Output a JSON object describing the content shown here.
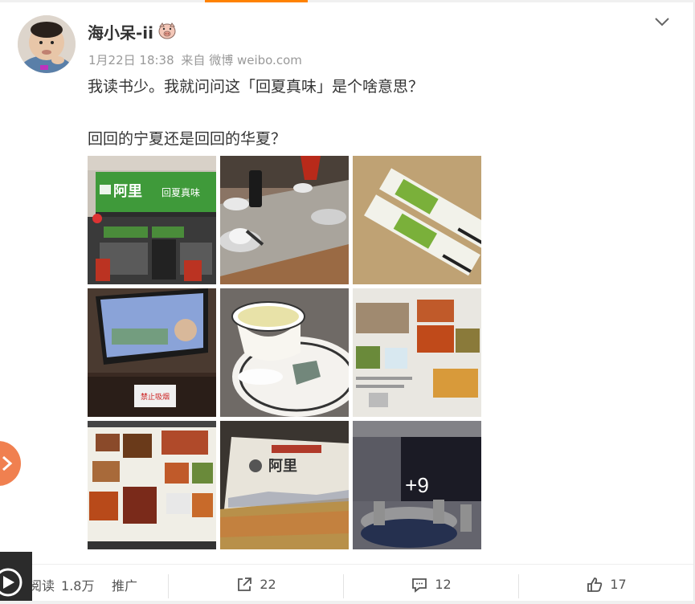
{
  "post": {
    "username": "海小呆-ii",
    "badge_icon": "pig-face-icon",
    "meta": {
      "time": "1月22日 18:38",
      "source": "来自 微博 weibo.com"
    },
    "text_line1": "我读书少。我就问问这「回夏真味」是个啥意思？",
    "text_line2": "回回的宁夏还是回回的华夏？",
    "images": [
      {
        "name": "restaurant-storefront-image",
        "sign": "阿里",
        "sign_sub": "回夏真味"
      },
      {
        "name": "table-setting-image"
      },
      {
        "name": "chopsticks-image"
      },
      {
        "name": "tv-screen-image",
        "sign": "禁止吸烟"
      },
      {
        "name": "teacup-image"
      },
      {
        "name": "menu-page-image"
      },
      {
        "name": "menu-spread-image"
      },
      {
        "name": "menu-cover-image"
      },
      {
        "name": "dining-room-image"
      }
    ],
    "more_count": "+9"
  },
  "footer": {
    "read_label": "阅读",
    "read_count": "1.8万",
    "promote_label": "推广",
    "share_count": "22",
    "comment_count": "12",
    "like_count": "17"
  },
  "colors": {
    "accent": "#ff8200",
    "side_button": "#f08050"
  }
}
